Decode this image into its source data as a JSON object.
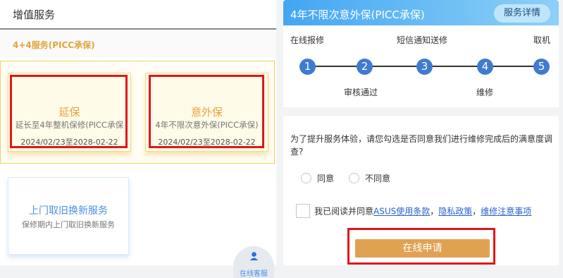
{
  "left": {
    "title": "增值服务",
    "package_name": "4+4服务(PICC承保)",
    "cards": [
      {
        "name": "延保",
        "desc": "延长至4年整机保修(PICC承保",
        "date": "2024/02/23至2028-02-22"
      },
      {
        "name": "意外保",
        "desc": "4年不限次意外保(PICC承保)",
        "date": "2024/02/23至2028-02-22"
      }
    ],
    "door_service": {
      "name": "上门取旧换新服务",
      "desc": "保修期内上门取旧换新服务"
    },
    "customer_service": "在线客服"
  },
  "right": {
    "banner_title": "4年不限次意外保(PICC承保)",
    "detail_button": "服务详情",
    "steps_top": [
      "在线报修",
      "短信通知送修",
      "取机"
    ],
    "steps_bottom": [
      "审核通过",
      "维修"
    ],
    "step_numbers": [
      "1",
      "2",
      "3",
      "4",
      "5"
    ],
    "question": "为了提升服务体验，请您勾选是否同意我们进行维修完成后的满意度调查?",
    "radio_agree": "同意",
    "radio_disagree": "不同意",
    "agreement_prefix": "我已阅读并同意",
    "agreement_links": [
      "ASUS使用条款",
      "隐私政策",
      "维修注意事项"
    ],
    "agreement_sep": "，",
    "apply_button": "在线申请"
  },
  "colors": {
    "accent_gold": "#e8a13c",
    "accent_blue": "#4a90e2",
    "step_blue": "#3f7bd0",
    "apply_button": "#e0a252",
    "highlight_red": "#e0161c"
  }
}
